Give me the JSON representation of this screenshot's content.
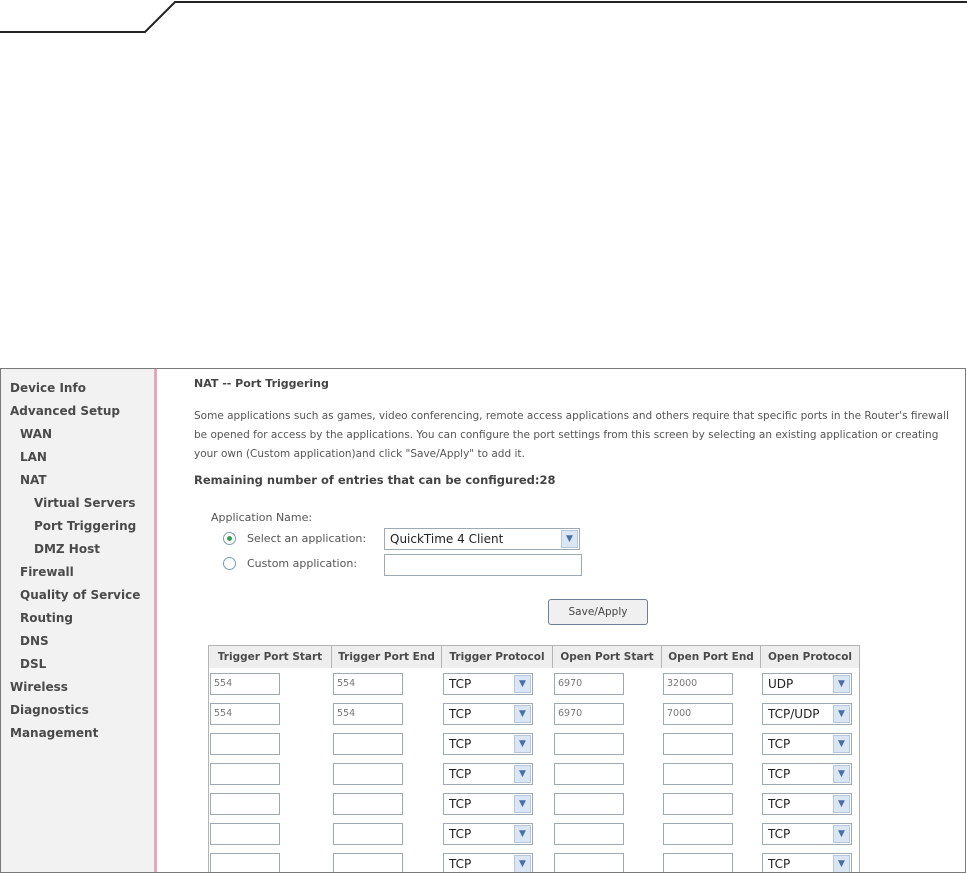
{
  "sidebar": {
    "items": [
      {
        "label": "Device Info"
      },
      {
        "label": "Advanced Setup"
      },
      {
        "label": "WAN"
      },
      {
        "label": "LAN"
      },
      {
        "label": "NAT"
      },
      {
        "label": "Virtual Servers"
      },
      {
        "label": "Port Triggering"
      },
      {
        "label": "DMZ Host"
      },
      {
        "label": "Firewall"
      },
      {
        "label": "Quality of Service"
      },
      {
        "label": "Routing"
      },
      {
        "label": "DNS"
      },
      {
        "label": "DSL"
      },
      {
        "label": "Wireless"
      },
      {
        "label": "Diagnostics"
      },
      {
        "label": "Management"
      }
    ]
  },
  "main": {
    "title": "NAT -- Port Triggering",
    "description": "Some applications such as games, video conferencing, remote access applications and others require that specific ports in the Router's firewall be opened for access by the applications. You can configure the port settings from this screen by selecting an existing application or creating your own (Custom application)and click \"Save/Apply\" to add it.",
    "remaining": "Remaining number of entries that can be configured:28",
    "app_name_label": "Application Name:",
    "select_app_label": "Select an application:",
    "select_app_value": "QuickTime 4 Client",
    "custom_app_label": "Custom application:",
    "custom_app_value": "",
    "save_button": "Save/Apply",
    "selected_option": "select"
  },
  "table": {
    "headers": [
      "Trigger Port Start",
      "Trigger Port End",
      "Trigger Protocol",
      "Open Port Start",
      "Open Port End",
      "Open Protocol"
    ],
    "rows": [
      {
        "trigger_start": "554",
        "trigger_end": "554",
        "trigger_protocol": "TCP",
        "open_start": "6970",
        "open_end": "32000",
        "open_protocol": "UDP"
      },
      {
        "trigger_start": "554",
        "trigger_end": "554",
        "trigger_protocol": "TCP",
        "open_start": "6970",
        "open_end": "7000",
        "open_protocol": "TCP/UDP"
      },
      {
        "trigger_start": "",
        "trigger_end": "",
        "trigger_protocol": "TCP",
        "open_start": "",
        "open_end": "",
        "open_protocol": "TCP"
      },
      {
        "trigger_start": "",
        "trigger_end": "",
        "trigger_protocol": "TCP",
        "open_start": "",
        "open_end": "",
        "open_protocol": "TCP"
      },
      {
        "trigger_start": "",
        "trigger_end": "",
        "trigger_protocol": "TCP",
        "open_start": "",
        "open_end": "",
        "open_protocol": "TCP"
      },
      {
        "trigger_start": "",
        "trigger_end": "",
        "trigger_protocol": "TCP",
        "open_start": "",
        "open_end": "",
        "open_protocol": "TCP"
      },
      {
        "trigger_start": "",
        "trigger_end": "",
        "trigger_protocol": "TCP",
        "open_start": "",
        "open_end": "",
        "open_protocol": "TCP"
      }
    ]
  },
  "icons": {
    "dropdown": "chevron-down-icon"
  },
  "colors": {
    "sidebar_bg": "#f2f2f2",
    "sidebar_border": "#e4a9b6",
    "radio_selected": "#39a04a",
    "dropdown_arrow": "#4a6fa5"
  }
}
